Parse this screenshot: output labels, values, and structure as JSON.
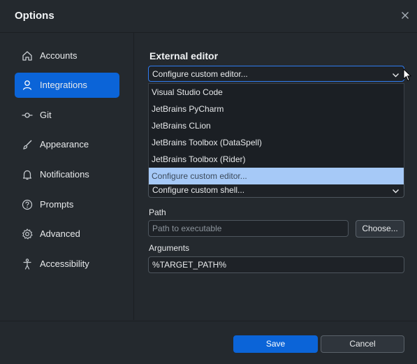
{
  "window": {
    "title": "Options"
  },
  "sidebar": {
    "items": [
      {
        "label": "Accounts",
        "icon": "home-icon"
      },
      {
        "label": "Integrations",
        "icon": "person-icon",
        "active": true
      },
      {
        "label": "Git",
        "icon": "commit-icon"
      },
      {
        "label": "Appearance",
        "icon": "brush-icon"
      },
      {
        "label": "Notifications",
        "icon": "bell-icon"
      },
      {
        "label": "Prompts",
        "icon": "question-icon"
      },
      {
        "label": "Advanced",
        "icon": "gear-icon"
      },
      {
        "label": "Accessibility",
        "icon": "accessibility-icon"
      }
    ]
  },
  "integrations": {
    "external_editor_title": "External editor",
    "external_editor_value": "Configure custom editor...",
    "editor_options": [
      "Visual Studio Code",
      "JetBrains PyCharm",
      "JetBrains CLion",
      "JetBrains Toolbox (DataSpell)",
      "JetBrains Toolbox (Rider)",
      "Configure custom editor..."
    ],
    "shell_value": "Configure custom shell...",
    "path_label": "Path",
    "path_placeholder": "Path to executable",
    "choose_button": "Choose...",
    "arguments_label": "Arguments",
    "arguments_value": "%TARGET_PATH%"
  },
  "footer": {
    "save": "Save",
    "cancel": "Cancel"
  },
  "colors": {
    "accent": "#0b64d8",
    "selected_option": "#a6c9f7",
    "background": "#24292e"
  }
}
